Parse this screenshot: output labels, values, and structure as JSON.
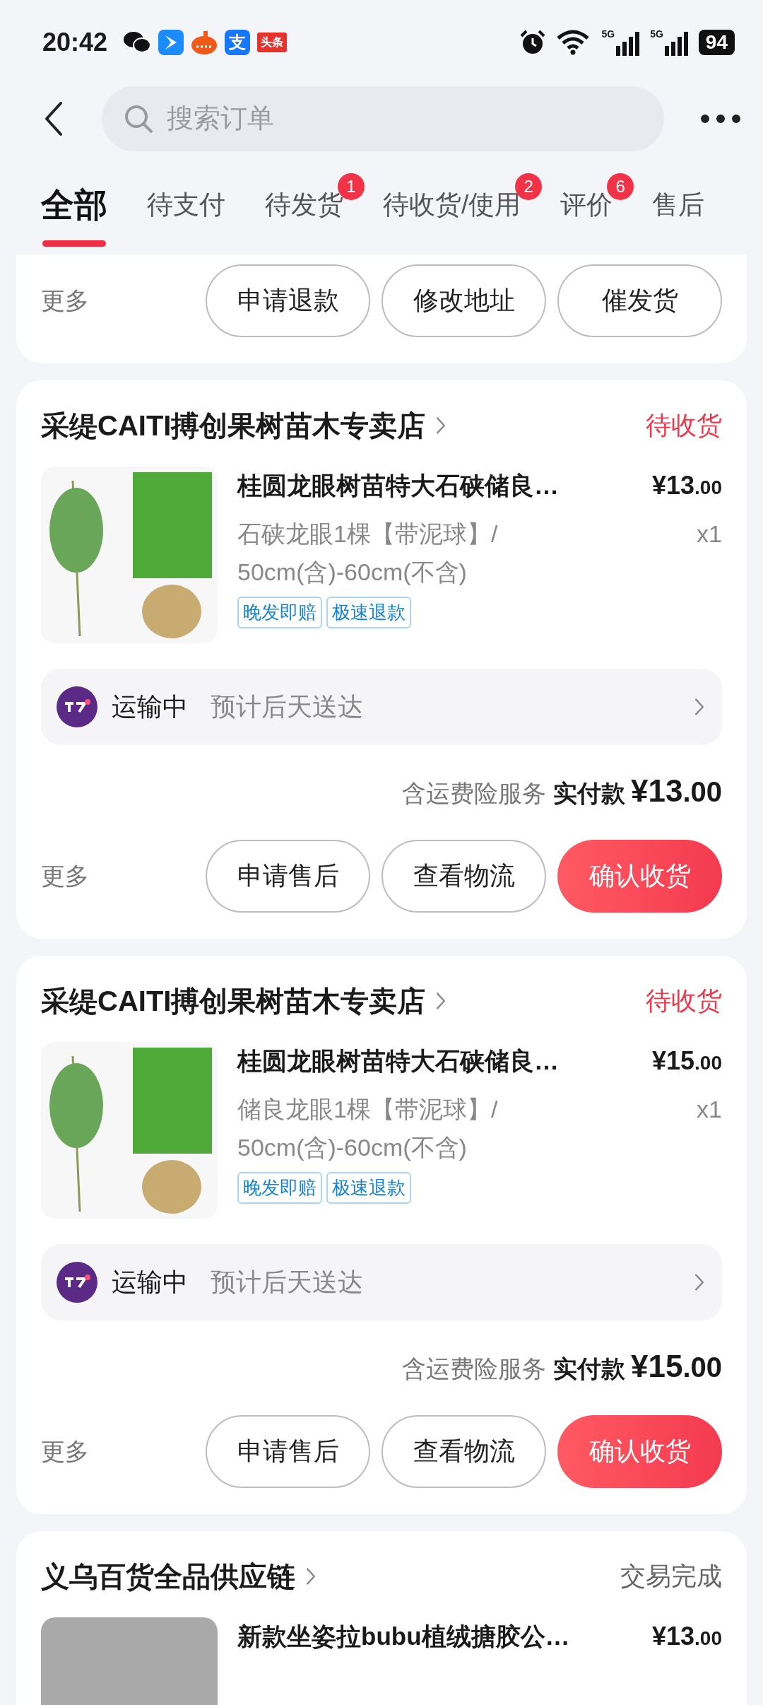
{
  "status_bar": {
    "time": "20:42",
    "notification_icons": [
      {
        "kind": "wechat"
      },
      {
        "kind": "blue-app"
      },
      {
        "kind": "orange-app"
      },
      {
        "kind": "alipay",
        "text": "支"
      },
      {
        "kind": "toutiao",
        "text": "头条"
      }
    ],
    "network_labels": [
      "5G",
      "5G"
    ],
    "battery": "94"
  },
  "header": {
    "search": {
      "placeholder": "搜索订单"
    }
  },
  "tabs": [
    {
      "label": "全部",
      "selected": true
    },
    {
      "label": "待支付",
      "selected": false
    },
    {
      "label": "待发货",
      "selected": false,
      "badge": "1"
    },
    {
      "label": "待收货/使用",
      "selected": false,
      "badge": "2"
    },
    {
      "label": "评价",
      "selected": false,
      "badge": "6"
    },
    {
      "label": "售后",
      "selected": false
    }
  ],
  "orders": [
    {
      "actions": {
        "more": "更多",
        "buttons": [
          {
            "label": "申请退款",
            "primary": false
          },
          {
            "label": "修改地址",
            "primary": false
          },
          {
            "label": "催发货",
            "primary": false
          }
        ]
      }
    },
    {
      "store": "采缇CAITI搏创果树苗木专卖店",
      "status": "待收货",
      "color": "#f0384a",
      "product": {
        "kind": "seedling",
        "title": "桂圆龙眼树苗特大石硖储良…",
        "price": "¥13.00",
        "spec": "石硖龙眼1棵【带泥球】/\n50cm(含)-60cm(不含)",
        "quantity": "x1",
        "tags": [
          "晚发即赔",
          "极速退款"
        ]
      },
      "logistics": {
        "status": "运输中",
        "eta": "预计后天送达"
      },
      "total": {
        "note": "含运费险服务",
        "label": "实付款",
        "amount": "¥13.00"
      },
      "actions": {
        "more": "更多",
        "buttons": [
          {
            "label": "申请售后",
            "primary": false
          },
          {
            "label": "查看物流",
            "primary": false
          },
          {
            "label": "确认收货",
            "primary": true
          }
        ]
      }
    },
    {
      "store": "采缇CAITI搏创果树苗木专卖店",
      "status": "待收货",
      "color": "#f0384a",
      "product": {
        "kind": "seedling",
        "title": "桂圆龙眼树苗特大石硖储良…",
        "price": "¥15.00",
        "spec": "储良龙眼1棵【带泥球】/\n50cm(含)-60cm(不含)",
        "quantity": "x1",
        "tags": [
          "晚发即赔",
          "极速退款"
        ]
      },
      "logistics": {
        "status": "运输中",
        "eta": "预计后天送达"
      },
      "total": {
        "note": "含运费险服务",
        "label": "实付款",
        "amount": "¥15.00"
      },
      "actions": {
        "more": "更多",
        "buttons": [
          {
            "label": "申请售后",
            "primary": false
          },
          {
            "label": "查看物流",
            "primary": false
          },
          {
            "label": "确认收货",
            "primary": true
          }
        ]
      }
    },
    {
      "store": "义乌百货全品供应链",
      "status": "交易完成",
      "color": "#666666",
      "product": {
        "kind": "plain",
        "title": "新款坐姿拉bubu植绒搪胶公…",
        "price": "¥13.00"
      }
    }
  ]
}
